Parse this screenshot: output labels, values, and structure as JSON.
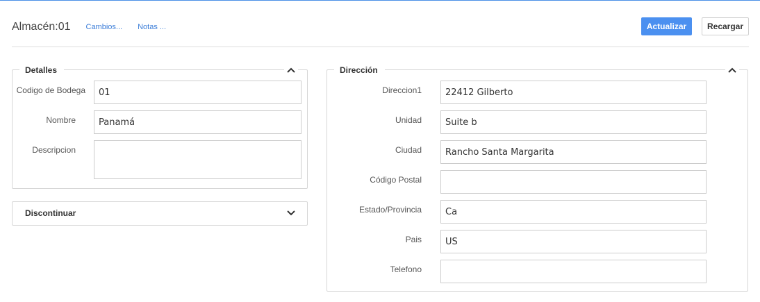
{
  "header": {
    "title": "Almacén:01",
    "links": [
      "Cambios...",
      "Notas ..."
    ],
    "actions": {
      "update": "Actualizar",
      "reload": "Recargar"
    }
  },
  "colors": {
    "accent": "#4b90f0",
    "link": "#3b7dd8",
    "border": "#d6d6d6"
  },
  "details": {
    "legend": "Detalles",
    "icon": "chevron-up-icon",
    "fields": {
      "code": {
        "label": "Codigo de Bodega",
        "value": "01"
      },
      "name": {
        "label": "Nombre",
        "value": "Panamá"
      },
      "description": {
        "label": "Descripcion",
        "value": ""
      }
    }
  },
  "discontinue": {
    "title": "Discontinuar",
    "icon": "chevron-down-icon"
  },
  "address": {
    "legend": "Dirección",
    "icon": "chevron-up-icon",
    "fields": {
      "line1": {
        "label": "Direccion1",
        "value": "22412 Gilberto"
      },
      "unit": {
        "label": "Unidad",
        "value": "Suite b"
      },
      "city": {
        "label": "Ciudad",
        "value": "Rancho Santa Margarita"
      },
      "postal": {
        "label": "Código Postal",
        "value": ""
      },
      "state": {
        "label": "Estado/Provincia",
        "value": "Ca"
      },
      "country": {
        "label": "Pais",
        "value": "US"
      },
      "phone": {
        "label": "Telefono",
        "value": ""
      }
    }
  }
}
